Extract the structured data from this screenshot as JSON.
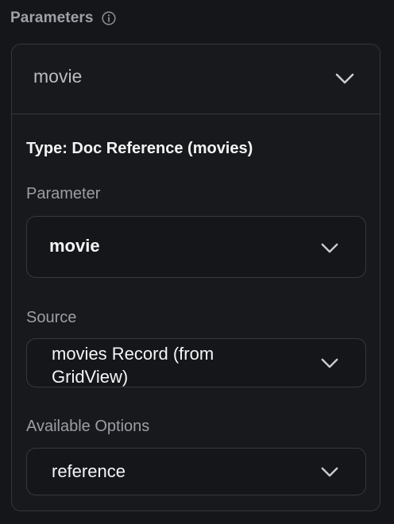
{
  "section": {
    "title": "Parameters",
    "info_icon": "info-icon"
  },
  "card": {
    "header_label": "movie",
    "type_text": "Type: Doc Reference (movies)",
    "parameter": {
      "label": "Parameter",
      "value": "movie"
    },
    "source": {
      "label": "Source",
      "value_line1": "movies Record (from",
      "value_line2": "GridView)"
    },
    "available_options": {
      "label": "Available Options",
      "value": "reference"
    }
  },
  "colors": {
    "background": "#141619",
    "card_border": "#33363c",
    "muted_text": "#9ea1a7",
    "primary_text": "#f4f5f6"
  },
  "icons": [
    "info-icon",
    "chevron-down-icon"
  ]
}
